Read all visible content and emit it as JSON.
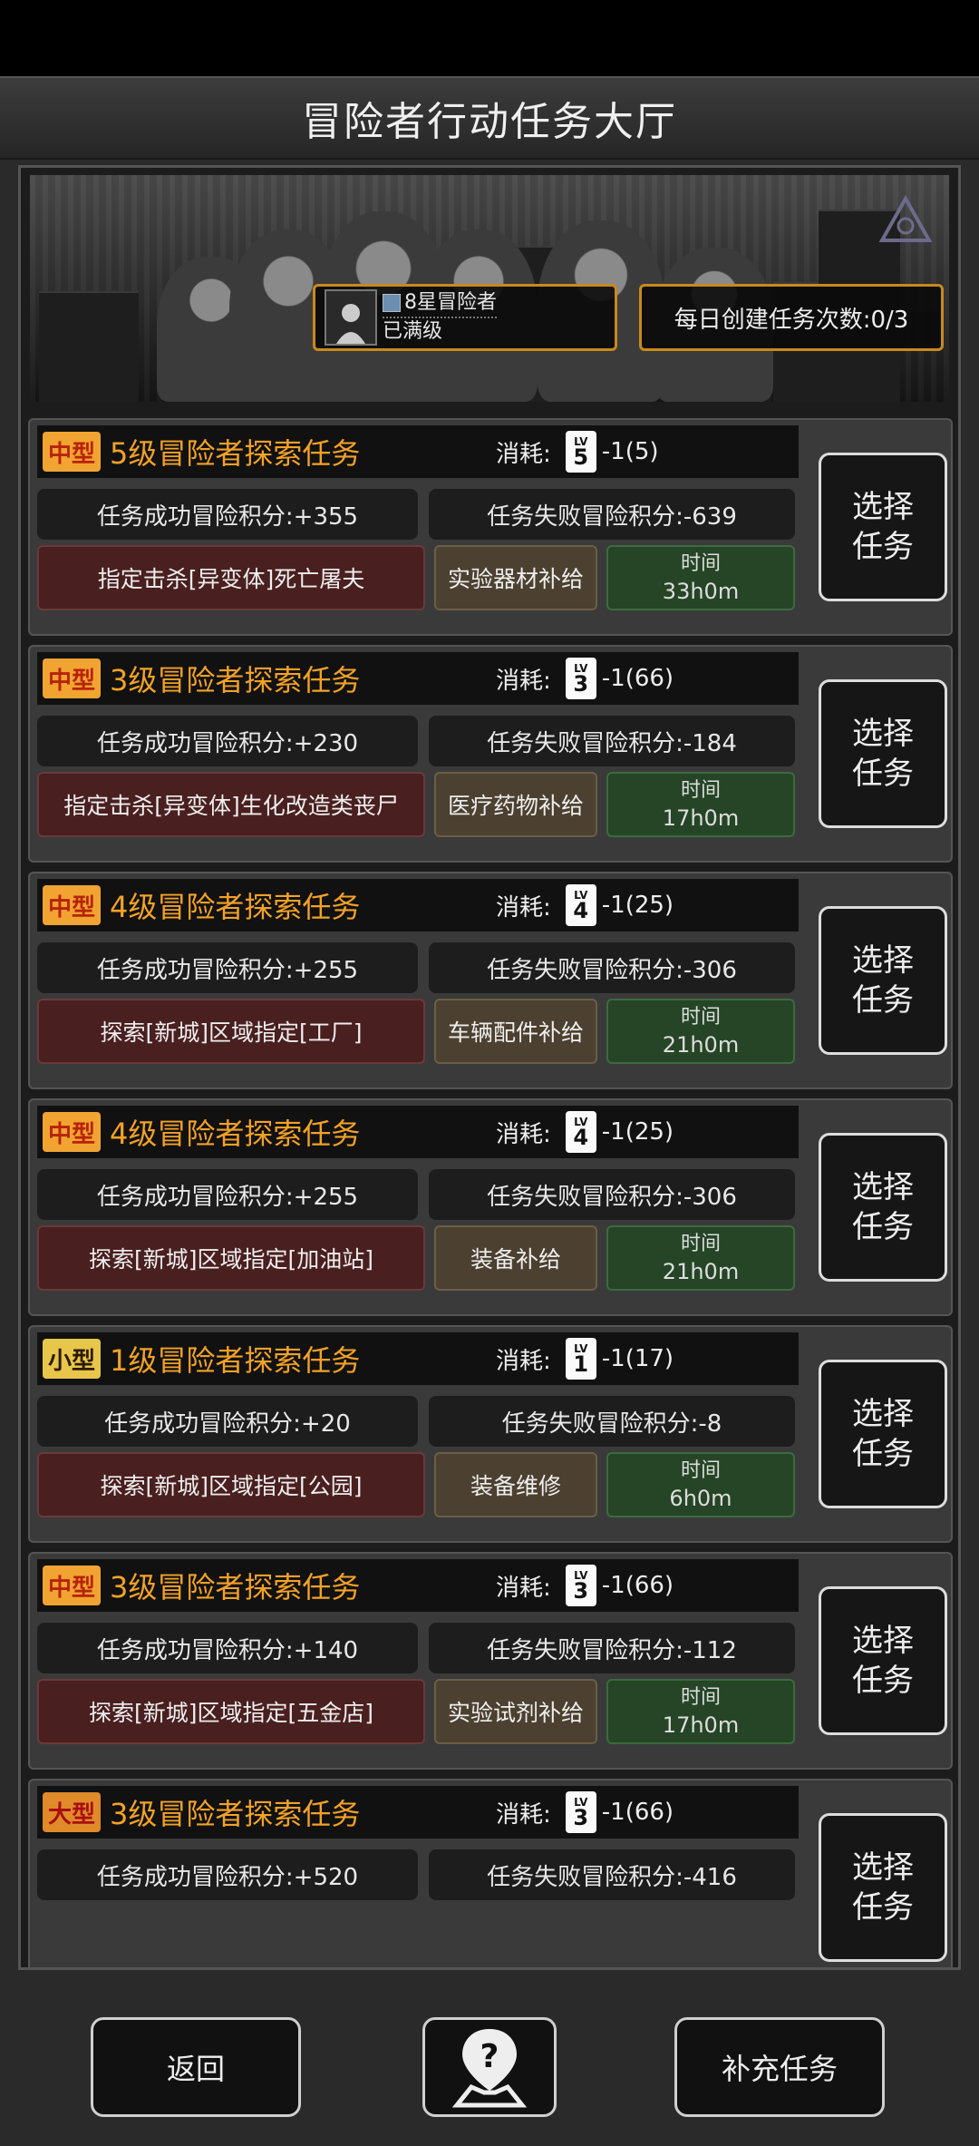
{
  "header": {
    "title": "冒险者行动任务大厅"
  },
  "player": {
    "rank": "8星冒险者",
    "status": "已满级"
  },
  "daily": {
    "text": "每日创建任务次数:0/3"
  },
  "labels": {
    "cost": "消耗:",
    "choose": "选择任务",
    "time": "时间"
  },
  "tasks": [
    {
      "size": "中型",
      "title": "5级冒险者探索任务",
      "badge": "5",
      "cost": "-1(5)",
      "success": "任务成功冒险积分:+355",
      "fail": "任务失败冒险积分:-639",
      "target": "指定击杀[异变体]死亡屠夫",
      "supply": "实验器材补给",
      "time": "33h0m"
    },
    {
      "size": "中型",
      "title": "3级冒险者探索任务",
      "badge": "3",
      "cost": "-1(66)",
      "success": "任务成功冒险积分:+230",
      "fail": "任务失败冒险积分:-184",
      "target": "指定击杀[异变体]生化改造类丧尸",
      "supply": "医疗药物补给",
      "time": "17h0m"
    },
    {
      "size": "中型",
      "title": "4级冒险者探索任务",
      "badge": "4",
      "cost": "-1(25)",
      "success": "任务成功冒险积分:+255",
      "fail": "任务失败冒险积分:-306",
      "target": "探索[新城]区域指定[工厂]",
      "supply": "车辆配件补给",
      "time": "21h0m"
    },
    {
      "size": "中型",
      "title": "4级冒险者探索任务",
      "badge": "4",
      "cost": "-1(25)",
      "success": "任务成功冒险积分:+255",
      "fail": "任务失败冒险积分:-306",
      "target": "探索[新城]区域指定[加油站]",
      "supply": "装备补给",
      "time": "21h0m"
    },
    {
      "size": "小型",
      "title": "1级冒险者探索任务",
      "badge": "1",
      "cost": "-1(17)",
      "success": "任务成功冒险积分:+20",
      "fail": "任务失败冒险积分:-8",
      "target": "探索[新城]区域指定[公园]",
      "supply": "装备维修",
      "time": "6h0m"
    },
    {
      "size": "中型",
      "title": "3级冒险者探索任务",
      "badge": "3",
      "cost": "-1(66)",
      "success": "任务成功冒险积分:+140",
      "fail": "任务失败冒险积分:-112",
      "target": "探索[新城]区域指定[五金店]",
      "supply": "实验试剂补给",
      "time": "17h0m"
    },
    {
      "size": "大型",
      "title": "3级冒险者探索任务",
      "badge": "3",
      "cost": "-1(66)",
      "success": "任务成功冒险积分:+520",
      "fail": "任务失败冒险积分:-416",
      "target": "",
      "supply": "",
      "time": ""
    }
  ],
  "footer": {
    "back": "返回",
    "help_icon": "question-map-icon",
    "refill": "补充任务"
  }
}
